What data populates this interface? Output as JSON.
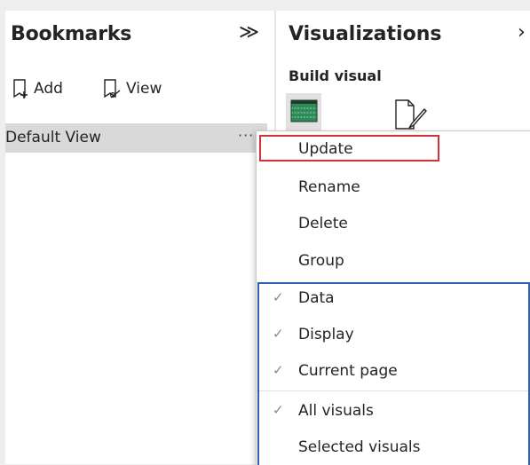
{
  "bookmarks": {
    "title": "Bookmarks",
    "collapse_glyph": "≫",
    "add_label": "Add",
    "view_label": "View",
    "items": [
      {
        "label": "Default View",
        "more_glyph": "···"
      }
    ]
  },
  "visualizations": {
    "title": "Visualizations",
    "expand_glyph": "›",
    "subtitle": "Build visual"
  },
  "context_menu": {
    "items": [
      {
        "label": "Update",
        "checked": false,
        "highlighted": true
      },
      {
        "label": "Rename",
        "checked": false
      },
      {
        "label": "Delete",
        "checked": false
      },
      {
        "label": "Group",
        "checked": false
      },
      {
        "label": "Data",
        "checked": true
      },
      {
        "label": "Display",
        "checked": true
      },
      {
        "label": "Current page",
        "checked": true
      },
      {
        "label": "All visuals",
        "checked": true
      },
      {
        "label": "Selected visuals",
        "checked": false
      }
    ],
    "check_glyph": "✓"
  },
  "colors": {
    "highlight_red": "#d13438",
    "group_blue": "#2f5fb3",
    "selected_item_bg": "#d9d9d9",
    "table_icon_green": "#2e8b57"
  },
  "icons": {
    "add": "add-bookmark-icon",
    "view": "view-bookmark-icon",
    "build_visual": "table-visual-icon",
    "format_visual": "format-paintbrush-icon"
  }
}
